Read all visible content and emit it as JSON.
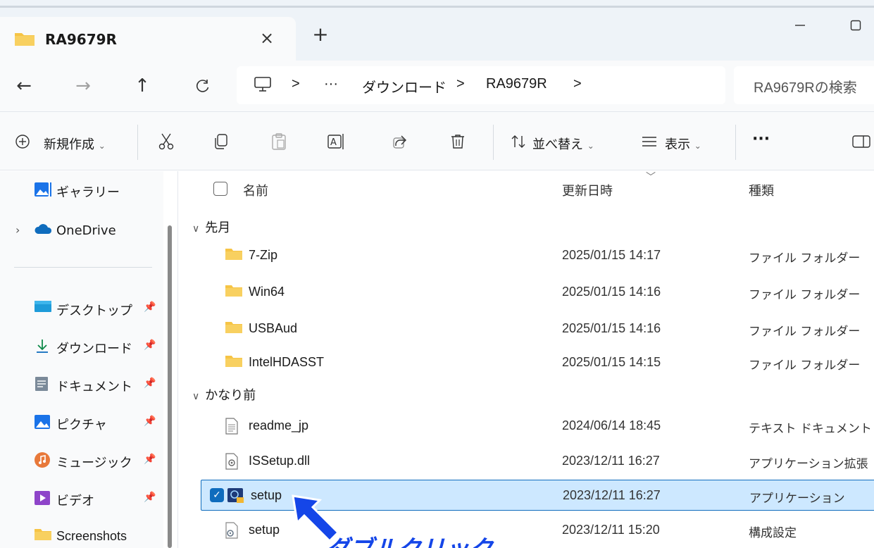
{
  "window": {
    "tab_title": "RA9679R",
    "tab_close_glyph": "×",
    "new_tab_glyph": "+"
  },
  "nav": {
    "back": "←",
    "forward": "→",
    "up": "↑",
    "refresh": "C"
  },
  "address": {
    "separator": ">",
    "ellipsis": "···",
    "crumbs": [
      "ダウンロード",
      "RA9679R"
    ],
    "search_placeholder": "RA9679Rの検索"
  },
  "commands": {
    "new": "新規作成",
    "sort": "並べ替え",
    "view": "表示",
    "more": "···"
  },
  "sidebar": {
    "items": [
      {
        "label": "ギャラリー",
        "icon": "gallery-icon"
      },
      {
        "label": "OneDrive",
        "icon": "onedrive-icon"
      },
      {
        "label": "デスクトップ",
        "icon": "desktop-icon"
      },
      {
        "label": "ダウンロード",
        "icon": "download-icon"
      },
      {
        "label": "ドキュメント",
        "icon": "documents-icon"
      },
      {
        "label": "ピクチャ",
        "icon": "pictures-icon"
      },
      {
        "label": "ミュージック",
        "icon": "music-icon"
      },
      {
        "label": "ビデオ",
        "icon": "videos-icon"
      },
      {
        "label": "Screenshots",
        "icon": "folder-icon"
      }
    ],
    "pin_glyph": "📌"
  },
  "list": {
    "headers": {
      "name": "名前",
      "date": "更新日時",
      "type": "種類"
    },
    "groups": [
      "先月",
      "かなり前"
    ],
    "rows": [
      {
        "name": "7-Zip",
        "date": "2025/01/15 14:17",
        "type": "ファイル フォルダー",
        "icon": "folder-icon"
      },
      {
        "name": "Win64",
        "date": "2025/01/15 14:16",
        "type": "ファイル フォルダー",
        "icon": "folder-icon"
      },
      {
        "name": "USBAud",
        "date": "2025/01/15 14:16",
        "type": "ファイル フォルダー",
        "icon": "folder-icon"
      },
      {
        "name": "IntelHDASST",
        "date": "2025/01/15 14:15",
        "type": "ファイル フォルダー",
        "icon": "folder-icon"
      },
      {
        "name": "readme_jp",
        "date": "2024/06/14 18:45",
        "type": "テキスト ドキュメント",
        "icon": "text-file-icon"
      },
      {
        "name": "ISSetup.dll",
        "date": "2023/12/11 16:27",
        "type": "アプリケーション拡張",
        "icon": "dll-file-icon"
      },
      {
        "name": "setup",
        "date": "2023/12/11 16:27",
        "type": "アプリケーション",
        "icon": "setup-app-icon",
        "selected": true
      },
      {
        "name": "setup",
        "date": "2023/12/11 15:20",
        "type": "構成設定",
        "icon": "config-file-icon"
      }
    ]
  },
  "annotation": {
    "text": "ダブルクリック",
    "color": "#1546e8"
  },
  "colors": {
    "accent": "#0f6cbd",
    "selection": "#cde8ff",
    "folder": "#f6c445"
  }
}
